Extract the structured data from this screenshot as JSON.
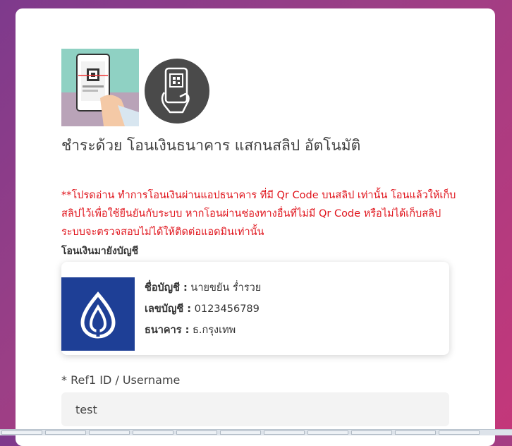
{
  "payment": {
    "title": "ชำระด้วย โอนเงินธนาคาร แสกนสลิป อัตโนมัติ",
    "warning": "**โปรดอ่าน ทำการโอนเงินผ่านแอปธนาคาร ที่มี Qr Code บนสลิป เท่านั้น โอนแล้วให้เก็บสลิปไว้เพื่อใช้ยืนยันกับระบบ หากโอนผ่านช่องทางอื่นที่ไม่มี Qr Code หรือไม่ได้เก็บสลิป ระบบจะตรวจสอบไม่ได้ให้ติดต่อแอดมินเท่านั้น",
    "transfer_label": "โอนเงินมายังบัญชี",
    "colors": {
      "warning": "#e0141c",
      "bank_brand": "#1e3f96"
    }
  },
  "account": {
    "name_label": "ชื่อบัญชี :",
    "name_value": "นายขยัน ร่ำรวย",
    "number_label": "เลขบัญชี :",
    "number_value": "0123456789",
    "bank_label": "ธนาคาร :",
    "bank_value": "ธ.กรุงเทพ"
  },
  "form": {
    "ref_label": "* Ref1 ID / Username",
    "ref_value": "test"
  },
  "icons": [
    "phone-scan-illustration",
    "qr-scan-icon",
    "bank-logo-icon"
  ]
}
